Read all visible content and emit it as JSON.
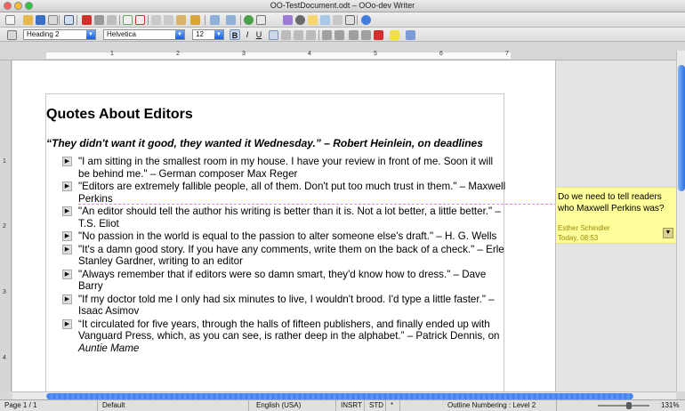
{
  "window": {
    "title": "OO-TestDocument.odt – OOo-dev Writer"
  },
  "toolbar2": {
    "paragraph_style": "Heading 2",
    "font_name": "Helvetica",
    "font_size": "12",
    "bold_label": "B",
    "italic_label": "I",
    "underline_label": "U"
  },
  "ruler": {
    "numbers": [
      "1",
      "2",
      "3",
      "4",
      "5",
      "6",
      "7"
    ]
  },
  "vruler": {
    "numbers": [
      "1",
      "2",
      "3",
      "4"
    ]
  },
  "document": {
    "heading": "Quotes About Editors",
    "lead_quote": "“They didn't want it good, they wanted it Wednesday.” – Robert Heinlein, on deadlines",
    "quotes": [
      "\"I am sitting in the smallest room in my house. I have your review in front of me. Soon it will be behind me.\" – German composer Max Reger",
      "\"Editors are extremely fallible people, all of them. Don't put too much trust in them.\" – Maxwell Perkins",
      "\"An editor should tell the author his writing is better than it is. Not a lot better, a little better.\" –  T.S. Eliot",
      "\"No passion in the world is equal to the passion to alter someone else's draft.\" – H. G. Wells",
      "\"It's a damn good story. If you have any comments, write them on the back of a check.\" – Erle Stanley Gardner, writing to an editor",
      "\"Always remember that if editors were so damn smart, they'd know how to dress.\" – Dave Barry",
      "\"If my doctor told me I only had six minutes to live, I wouldn't brood. I'd type a little faster.\" – Isaac Asimov"
    ],
    "last_quote_prefix": "“It circulated for five years, through the halls of fifteen publishers, and finally ended up with Vanguard Press, which, as you can see, is rather deep in the alphabet.” – Patrick Dennis, on ",
    "last_quote_title": "Auntie Mame"
  },
  "comment": {
    "text": "Do we need to tell readers who Maxwell Perkins was?",
    "author": "Esther Schindler",
    "date": "Today, 08:53"
  },
  "status": {
    "page": "Page 1 / 1",
    "page_style": "Default",
    "language": "English (USA)",
    "insert_mode": "INSRT",
    "selection_mode": "STD",
    "modified": "*",
    "numbering": "Outline Numbering : Level 2",
    "zoom": "131%"
  },
  "colors": {
    "accent": "#2f73e0",
    "comment_bg": "#fdfd9a",
    "connector": "#e6b400"
  }
}
